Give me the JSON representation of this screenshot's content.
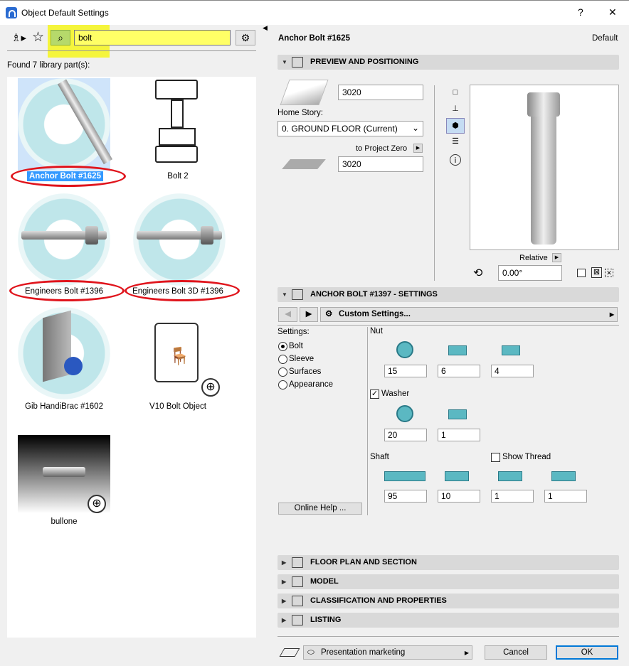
{
  "window": {
    "title": "Object Default Settings",
    "help": "?",
    "close": "✕"
  },
  "library": {
    "search_value": "bolt",
    "found_text": "Found 7 library part(s):",
    "items": [
      {
        "label": "Anchor Bolt #1625"
      },
      {
        "label": "Bolt 2"
      },
      {
        "label": "Engineers Bolt #1396"
      },
      {
        "label": "Engineers Bolt 3D #1396"
      },
      {
        "label": "Gib HandiBrac #1602"
      },
      {
        "label": "V10 Bolt Object"
      },
      {
        "label": "bullone"
      }
    ],
    "highlight_color": "#f5f53c",
    "annotation_color": "#e0141c",
    "selected_color": "#3399ff"
  },
  "header": {
    "object_name": "Anchor Bolt #1625",
    "default_label": "Default"
  },
  "preview": {
    "section_title": "PREVIEW AND POSITIONING",
    "height_value": "3020",
    "home_story_label": "Home Story:",
    "home_story_value": "0. GROUND FLOOR (Current)",
    "to_project_zero": "to Project Zero",
    "elevation_value": "3020",
    "relative_label": "Relative",
    "rotation_value": "0.00°"
  },
  "settings": {
    "section_title": "ANCHOR BOLT #1397 - SETTINGS",
    "custom_settings": "Custom Settings...",
    "settings_label": "Settings:",
    "options": [
      {
        "label": "Bolt",
        "checked": true
      },
      {
        "label": "Sleeve",
        "checked": false
      },
      {
        "label": "Surfaces",
        "checked": false
      },
      {
        "label": "Appearance",
        "checked": false
      }
    ],
    "online_help": "Online Help ...",
    "nut": {
      "label": "Nut",
      "values": [
        "15",
        "6",
        "4"
      ]
    },
    "washer": {
      "label": "Washer",
      "checked": true,
      "values": [
        "20",
        "1"
      ]
    },
    "shaft": {
      "label": "Shaft",
      "show_thread_label": "Show Thread",
      "show_thread": false,
      "values": [
        "95",
        "10",
        "1",
        "1"
      ]
    }
  },
  "sections": [
    {
      "label": "FLOOR PLAN AND SECTION"
    },
    {
      "label": "MODEL"
    },
    {
      "label": "CLASSIFICATION AND PROPERTIES"
    },
    {
      "label": "LISTING"
    }
  ],
  "footer": {
    "view_value": "Presentation marketing",
    "cancel": "Cancel",
    "ok": "OK"
  }
}
